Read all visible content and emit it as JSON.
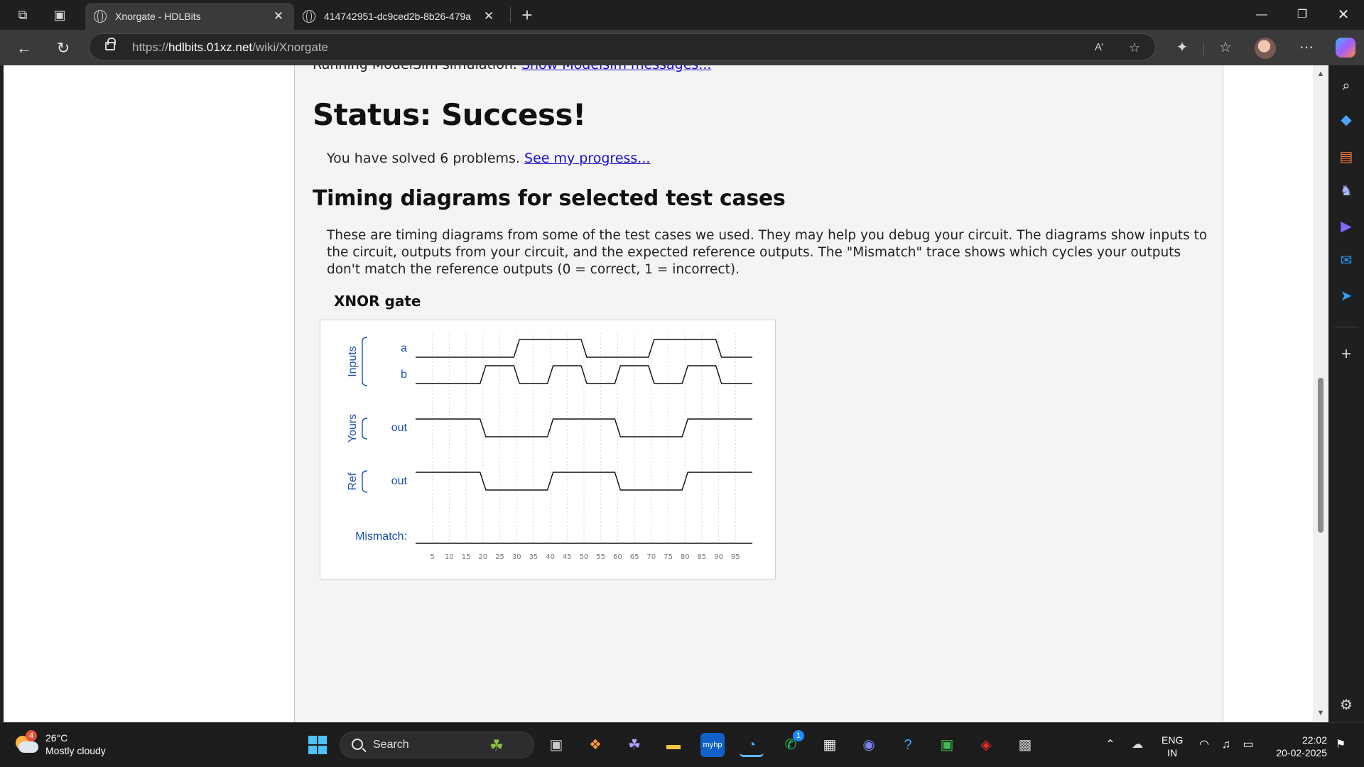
{
  "browser": {
    "tabs": [
      {
        "title": "Xnorgate - HDLBits",
        "active": true
      },
      {
        "title": "414742951-dc9ced2b-8b26-479a",
        "active": false
      }
    ],
    "url_prefix": "https://",
    "url_host": "hdlbits.01xz.net",
    "url_path": "/wiki/Xnorgate"
  },
  "page": {
    "running_prefix": "Running ModelSim simulation. ",
    "running_link": "Show Modelsim messages...",
    "status_title": "Status: Success!",
    "solved_text": "You have solved 6 problems. ",
    "solved_link": "See my progress...",
    "timing_title": "Timing diagrams for selected test cases",
    "timing_description": "These are timing diagrams from some of the test cases we used. They may help you debug your circuit. The diagrams show inputs to the circuit, outputs from your circuit, and the expected reference outputs. The \"Mismatch\" trace shows which cycles your outputs don't match the reference outputs (0 = correct, 1 = incorrect).",
    "diagram_title": "XNOR gate"
  },
  "chart_data": {
    "type": "timing",
    "groups": [
      "Inputs",
      "Yours",
      "Ref"
    ],
    "signals": [
      {
        "name": "a",
        "group": "Inputs",
        "t": [
          0,
          30,
          50,
          70,
          90
        ],
        "v": [
          0,
          1,
          0,
          1,
          0
        ]
      },
      {
        "name": "b",
        "group": "Inputs",
        "t": [
          0,
          20,
          30,
          40,
          50,
          60,
          70,
          80,
          90
        ],
        "v": [
          0,
          1,
          0,
          1,
          0,
          1,
          0,
          1,
          0
        ]
      },
      {
        "name": "out",
        "group": "Yours",
        "t": [
          0,
          20,
          40,
          60,
          80
        ],
        "v": [
          1,
          0,
          1,
          0,
          1
        ]
      },
      {
        "name": "out",
        "group": "Ref",
        "t": [
          0,
          20,
          40,
          60,
          80
        ],
        "v": [
          1,
          0,
          1,
          0,
          1
        ]
      }
    ],
    "mismatch_label": "Mismatch:",
    "mismatch": {
      "t": [
        0
      ],
      "v": [
        0
      ]
    },
    "x_ticks": [
      5,
      10,
      15,
      20,
      25,
      30,
      35,
      40,
      45,
      50,
      55,
      60,
      65,
      70,
      75,
      80,
      85,
      90,
      95
    ],
    "xlim": [
      0,
      100
    ],
    "label_color": "#1c4fb0"
  },
  "sidebar": {
    "icons": [
      "search-icon",
      "tag-icon",
      "briefcase-icon",
      "chess-icon",
      "copilot-icon",
      "outlook-icon",
      "send-icon",
      "add-icon",
      "settings-icon"
    ]
  },
  "taskbar": {
    "weather_badge": "4",
    "weather_temp": "26°C",
    "weather_desc": "Mostly cloudy",
    "search_label": "Search",
    "whatsapp_badge": "1",
    "lang_top": "ENG",
    "lang_bottom": "IN",
    "time": "22:02",
    "date": "20-02-2025"
  }
}
